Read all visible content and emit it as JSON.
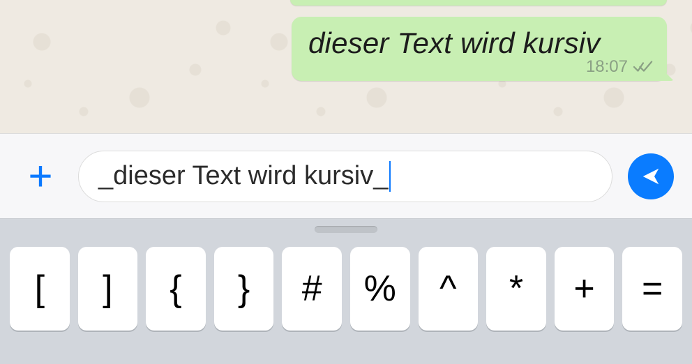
{
  "chat": {
    "outgoing_prev": {
      "text": ""
    },
    "outgoing": {
      "text": "dieser Text wird kursiv",
      "time": "18:07",
      "status": "delivered"
    }
  },
  "compose": {
    "plus_label": "+",
    "text": "_dieser Text wird kursiv_",
    "send_icon": "send-icon"
  },
  "keyboard": {
    "row1": [
      "[",
      "]",
      "{",
      "}",
      "#",
      "%",
      "^",
      "*",
      "+",
      "="
    ]
  },
  "colors": {
    "bubble_out": "#c8efb3",
    "accent_blue": "#0a7cff",
    "kb_bg": "#d2d6dc"
  }
}
